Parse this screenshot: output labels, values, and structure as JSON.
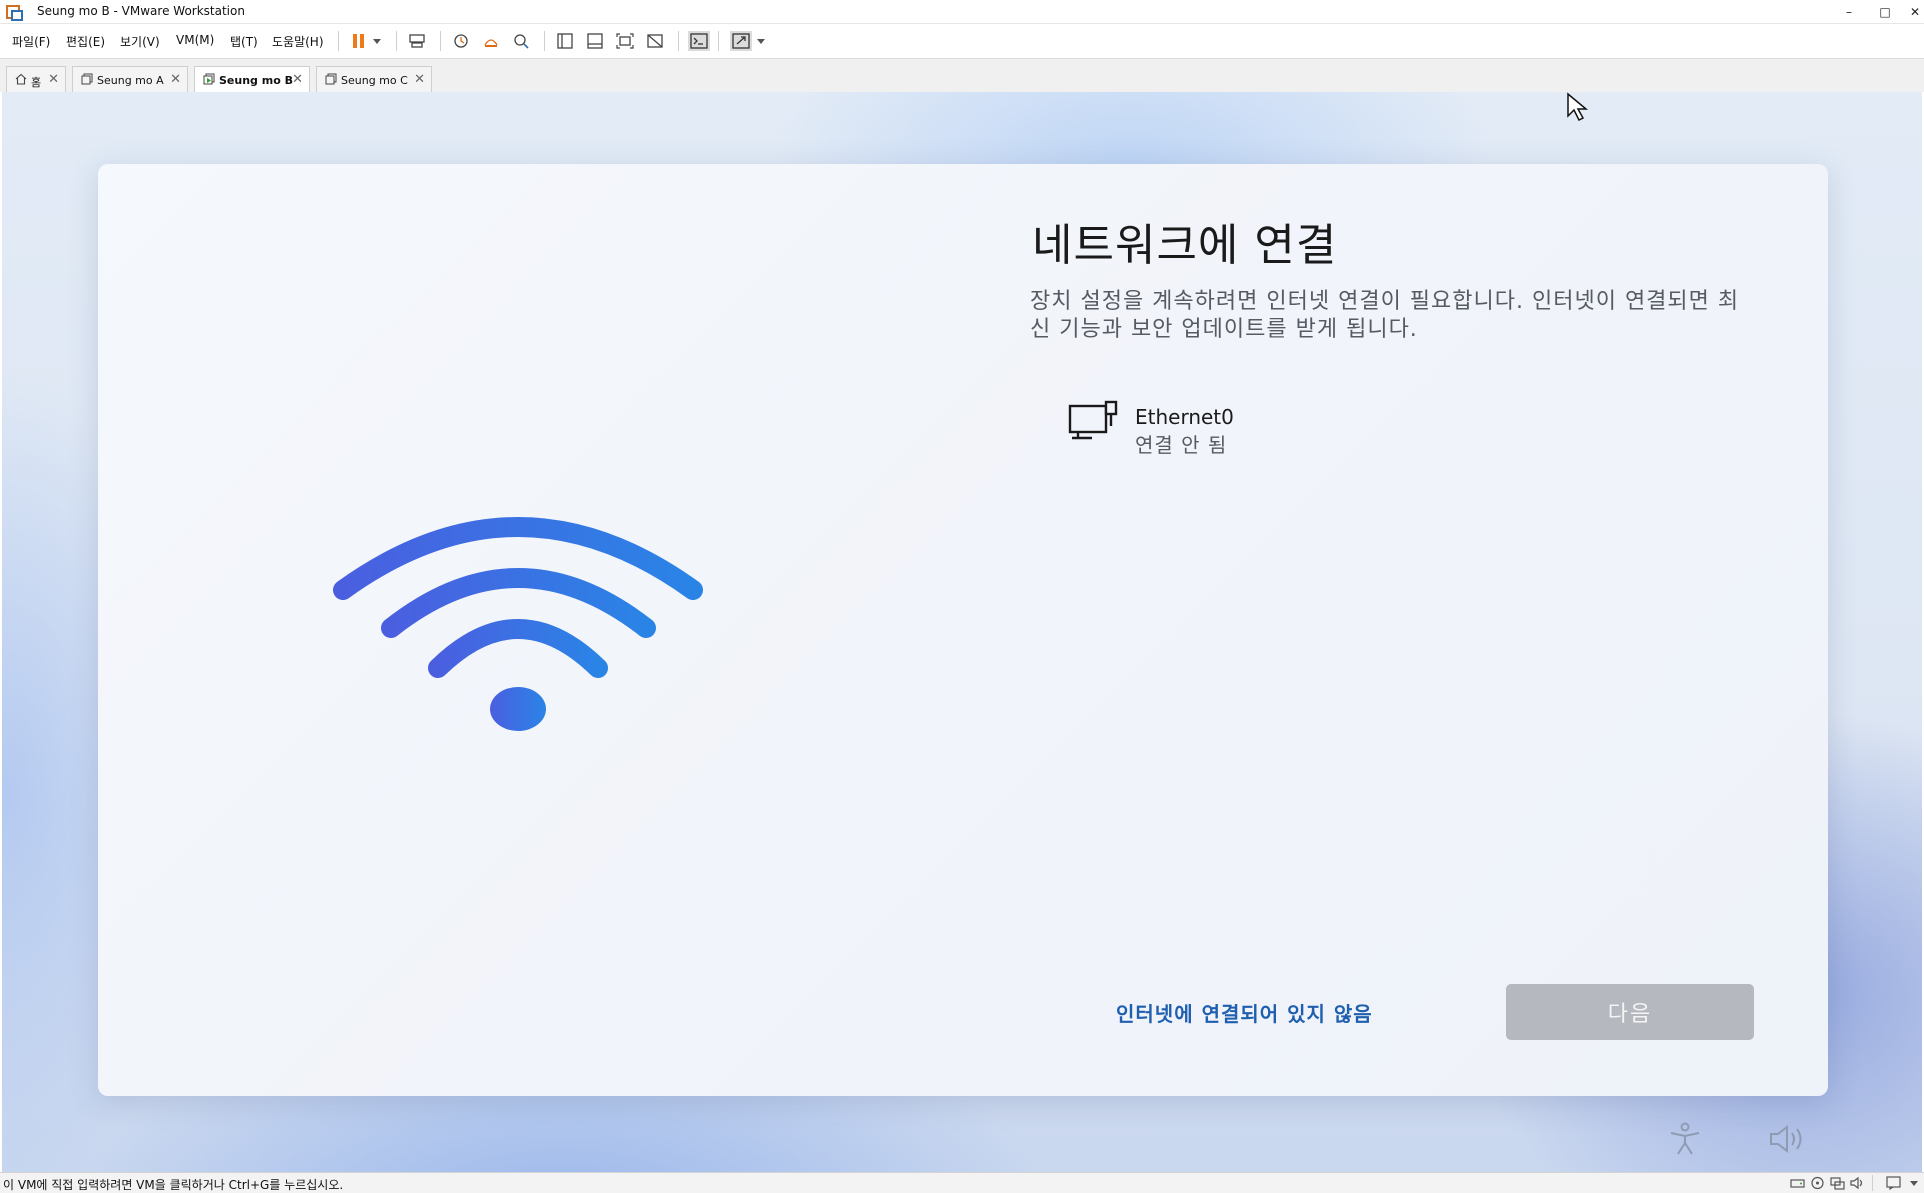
{
  "window": {
    "title": "Seung mo B - VMware Workstation",
    "minimize": "–",
    "maximize": "□",
    "close": "✕"
  },
  "menu": [
    {
      "label": "파일(F)"
    },
    {
      "label": "편집(E)"
    },
    {
      "label": "보기(V)"
    },
    {
      "label": "VM(M)"
    },
    {
      "label": "탭(T)"
    },
    {
      "label": "도움말(H)"
    }
  ],
  "toolbar_icons": [
    "pause-icon",
    "dropdown-icon",
    "send-ctrl-alt-del-icon",
    "snapshot-icon",
    "revert-snapshot-icon",
    "snapshot-manager-icon",
    "library-icon",
    "thumbnail-bar-icon",
    "full-screen-icon",
    "unity-icon",
    "console-icon",
    "stretch-icon",
    "dropdown-icon"
  ],
  "tabs": [
    {
      "label": "홈",
      "icon": "home-icon",
      "active": false
    },
    {
      "label": "Seung mo A",
      "icon": "vm-icon",
      "active": false
    },
    {
      "label": "Seung mo B",
      "icon": "vm-running-icon",
      "active": true
    },
    {
      "label": "Seung mo C",
      "icon": "vm-icon",
      "active": false
    }
  ],
  "tab_close": "✕",
  "oobe": {
    "heading": "네트워크에 연결",
    "description": "장치 설정을 계속하려면 인터넷 연결이 필요합니다. 인터넷이 연결되면 최신 기능과 보안 업데이트를 받게 됩니다.",
    "network": {
      "name": "Ethernet0",
      "status": "연결 안 됨",
      "icon": "ethernet-icon"
    },
    "no_internet_link": "인터넷에 연결되어 있지 않음",
    "next_button": "다음",
    "accent_color": "#1f5fb0",
    "wifi_gradient": [
      "#4a5fe0",
      "#2a84e6"
    ]
  },
  "status": {
    "message": "이 VM에 직접 입력하려면 VM을 클릭하거나 Ctrl+G를 누르십시오."
  }
}
